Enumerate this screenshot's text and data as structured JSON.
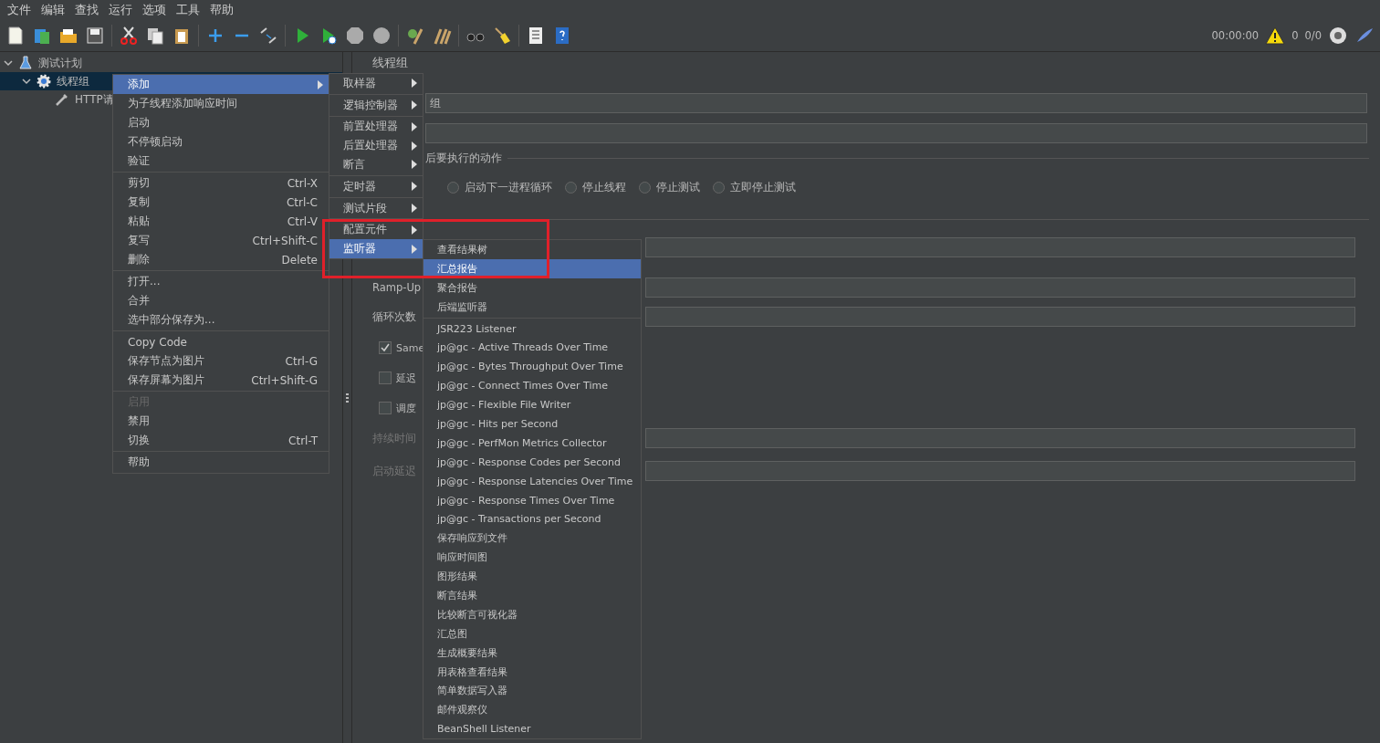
{
  "menubar": [
    "文件",
    "编辑",
    "查找",
    "运行",
    "选项",
    "工具",
    "帮助"
  ],
  "status": {
    "elapsed": "00:00:00",
    "warnings": "0",
    "threads": "0/0"
  },
  "tree": [
    {
      "label": "测试计划",
      "kind": "plan",
      "selected": false,
      "expanded": true,
      "children": [
        {
          "label": "线程组",
          "kind": "group",
          "selected": true,
          "expanded": true,
          "children": [
            {
              "label": "HTTP请",
              "kind": "sampler",
              "selected": false
            }
          ]
        }
      ]
    }
  ],
  "panel": {
    "title": "线程组",
    "name_value": "组",
    "section_label": "后要执行的动作",
    "radios": [
      {
        "label": "启动下一进程循环",
        "selected": false
      },
      {
        "label": "停止线程",
        "selected": false
      },
      {
        "label": "停止测试",
        "selected": false
      },
      {
        "label": "立即停止测试",
        "selected": false
      }
    ],
    "ramp_label": "Ramp-Up",
    "loop_label": "循环次数",
    "checkboxes": [
      {
        "label": "Same",
        "checked": true
      },
      {
        "label": "延迟",
        "checked": false
      },
      {
        "label": "调度",
        "checked": false
      }
    ],
    "duration_label": "持续时间",
    "delay_label": "启动延迟"
  },
  "context_menu": [
    [
      {
        "label": "添加",
        "submenu": true,
        "selected": true,
        "disabled": false
      },
      {
        "label": "为子线程添加响应时间",
        "submenu": false,
        "selected": false,
        "disabled": false
      },
      {
        "label": "启动",
        "submenu": false,
        "selected": false,
        "disabled": false
      },
      {
        "label": "不停顿启动",
        "submenu": false,
        "selected": false,
        "disabled": false
      },
      {
        "label": "验证",
        "submenu": false,
        "selected": false,
        "disabled": false
      }
    ],
    [
      {
        "label": "剪切",
        "shortcut": "Ctrl-X",
        "submenu": false,
        "selected": false,
        "disabled": false
      },
      {
        "label": "复制",
        "shortcut": "Ctrl-C",
        "submenu": false,
        "selected": false,
        "disabled": false
      },
      {
        "label": "粘贴",
        "shortcut": "Ctrl-V",
        "submenu": false,
        "selected": false,
        "disabled": false
      },
      {
        "label": "复写",
        "shortcut": "Ctrl+Shift-C",
        "submenu": false,
        "selected": false,
        "disabled": false
      },
      {
        "label": "删除",
        "shortcut": "Delete",
        "submenu": false,
        "selected": false,
        "disabled": false
      }
    ],
    [
      {
        "label": "打开...",
        "submenu": false,
        "selected": false,
        "disabled": false
      },
      {
        "label": "合并",
        "submenu": false,
        "selected": false,
        "disabled": false
      },
      {
        "label": "选中部分保存为...",
        "submenu": false,
        "selected": false,
        "disabled": false
      }
    ],
    [
      {
        "label": "Copy Code",
        "submenu": false,
        "selected": false,
        "disabled": false
      },
      {
        "label": "保存节点为图片",
        "shortcut": "Ctrl-G",
        "submenu": false,
        "selected": false,
        "disabled": false
      },
      {
        "label": "保存屏幕为图片",
        "shortcut": "Ctrl+Shift-G",
        "submenu": false,
        "selected": false,
        "disabled": false
      }
    ],
    [
      {
        "label": "启用",
        "submenu": false,
        "selected": false,
        "disabled": true
      },
      {
        "label": "禁用",
        "submenu": false,
        "selected": false,
        "disabled": false
      },
      {
        "label": "切换",
        "shortcut": "Ctrl-T",
        "submenu": false,
        "selected": false,
        "disabled": false
      }
    ],
    [
      {
        "label": "帮助",
        "submenu": false,
        "selected": false,
        "disabled": false
      }
    ]
  ],
  "add_menu": [
    [
      {
        "label": "取样器",
        "selected": false
      }
    ],
    [
      {
        "label": "逻辑控制器",
        "selected": false
      }
    ],
    [
      {
        "label": "前置处理器",
        "selected": false
      },
      {
        "label": "后置处理器",
        "selected": false
      },
      {
        "label": "断言",
        "selected": false
      }
    ],
    [
      {
        "label": "定时器",
        "selected": false
      }
    ],
    [
      {
        "label": "测试片段",
        "selected": false
      }
    ],
    [
      {
        "label": "配置元件",
        "selected": false
      },
      {
        "label": "监听器",
        "selected": true
      }
    ]
  ],
  "listener_menu": [
    [
      {
        "label": "查看结果树",
        "selected": false
      },
      {
        "label": "汇总报告",
        "selected": true
      },
      {
        "label": "聚合报告",
        "selected": false
      },
      {
        "label": "后端监听器",
        "selected": false
      }
    ],
    [
      {
        "label": "JSR223 Listener",
        "selected": false
      },
      {
        "label": "jp@gc - Active Threads Over Time",
        "selected": false
      },
      {
        "label": "jp@gc - Bytes Throughput Over Time",
        "selected": false
      },
      {
        "label": "jp@gc - Connect Times Over Time",
        "selected": false
      },
      {
        "label": "jp@gc - Flexible File Writer",
        "selected": false
      },
      {
        "label": "jp@gc - Hits per Second",
        "selected": false
      },
      {
        "label": "jp@gc - PerfMon Metrics Collector",
        "selected": false
      },
      {
        "label": "jp@gc - Response Codes per Second",
        "selected": false
      },
      {
        "label": "jp@gc - Response Latencies Over Time",
        "selected": false
      },
      {
        "label": "jp@gc - Response Times Over Time",
        "selected": false
      },
      {
        "label": "jp@gc - Transactions per Second",
        "selected": false
      },
      {
        "label": "保存响应到文件",
        "selected": false
      },
      {
        "label": "响应时间图",
        "selected": false
      },
      {
        "label": "图形结果",
        "selected": false
      },
      {
        "label": "断言结果",
        "selected": false
      },
      {
        "label": "比较断言可视化器",
        "selected": false
      },
      {
        "label": "汇总图",
        "selected": false
      },
      {
        "label": "生成概要结果",
        "selected": false
      },
      {
        "label": "用表格查看结果",
        "selected": false
      },
      {
        "label": "简单数据写入器",
        "selected": false
      },
      {
        "label": "邮件观察仪",
        "selected": false
      },
      {
        "label": "BeanShell Listener",
        "selected": false
      }
    ]
  ]
}
